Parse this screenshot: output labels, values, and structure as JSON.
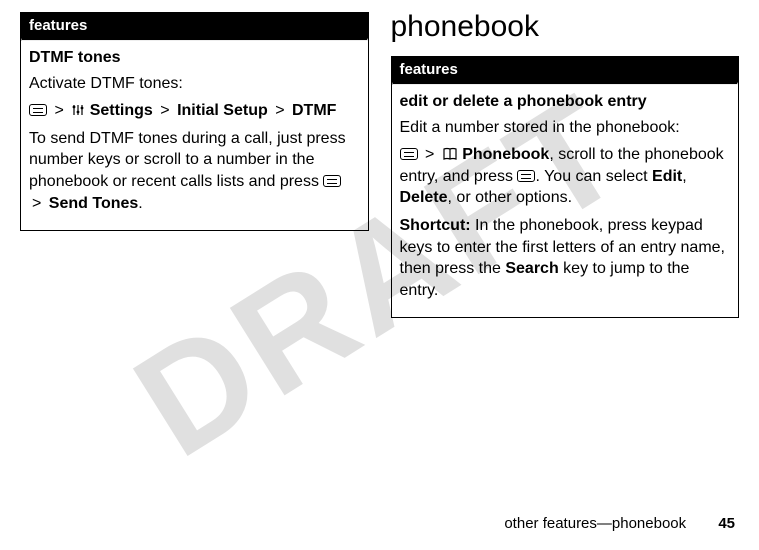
{
  "watermark": "DRAFT",
  "left": {
    "header": "features",
    "title": "DTMF tones",
    "intro": "Activate DTMF tones:",
    "path": {
      "settings": "Settings",
      "initial_setup": "Initial Setup",
      "dtmf": "DTMF"
    },
    "body1": "To send DTMF tones during a call, just press number keys or scroll to a number in the phonebook or recent calls lists and press ",
    "send_tones": "Send Tones",
    "period": "."
  },
  "right": {
    "heading": "phonebook",
    "header": "features",
    "title": "edit or delete a phonebook entry",
    "intro": "Edit a number stored in the phonebook:",
    "phonebook_label": "Phonebook",
    "body1": ", scroll to the phonebook entry, and press ",
    "body2": ". You can select ",
    "edit": "Edit",
    "comma": ", ",
    "delete": "Delete",
    "body3": ", or other options.",
    "shortcut_label": "Shortcut:",
    "shortcut_body1": " In the phonebook, press keypad keys to enter the first letters of an entry name, then press the ",
    "search": "Search",
    "shortcut_body2": " key to jump to the entry."
  },
  "footer": {
    "label": "other features—phonebook",
    "page": "45"
  },
  "gt": ">"
}
